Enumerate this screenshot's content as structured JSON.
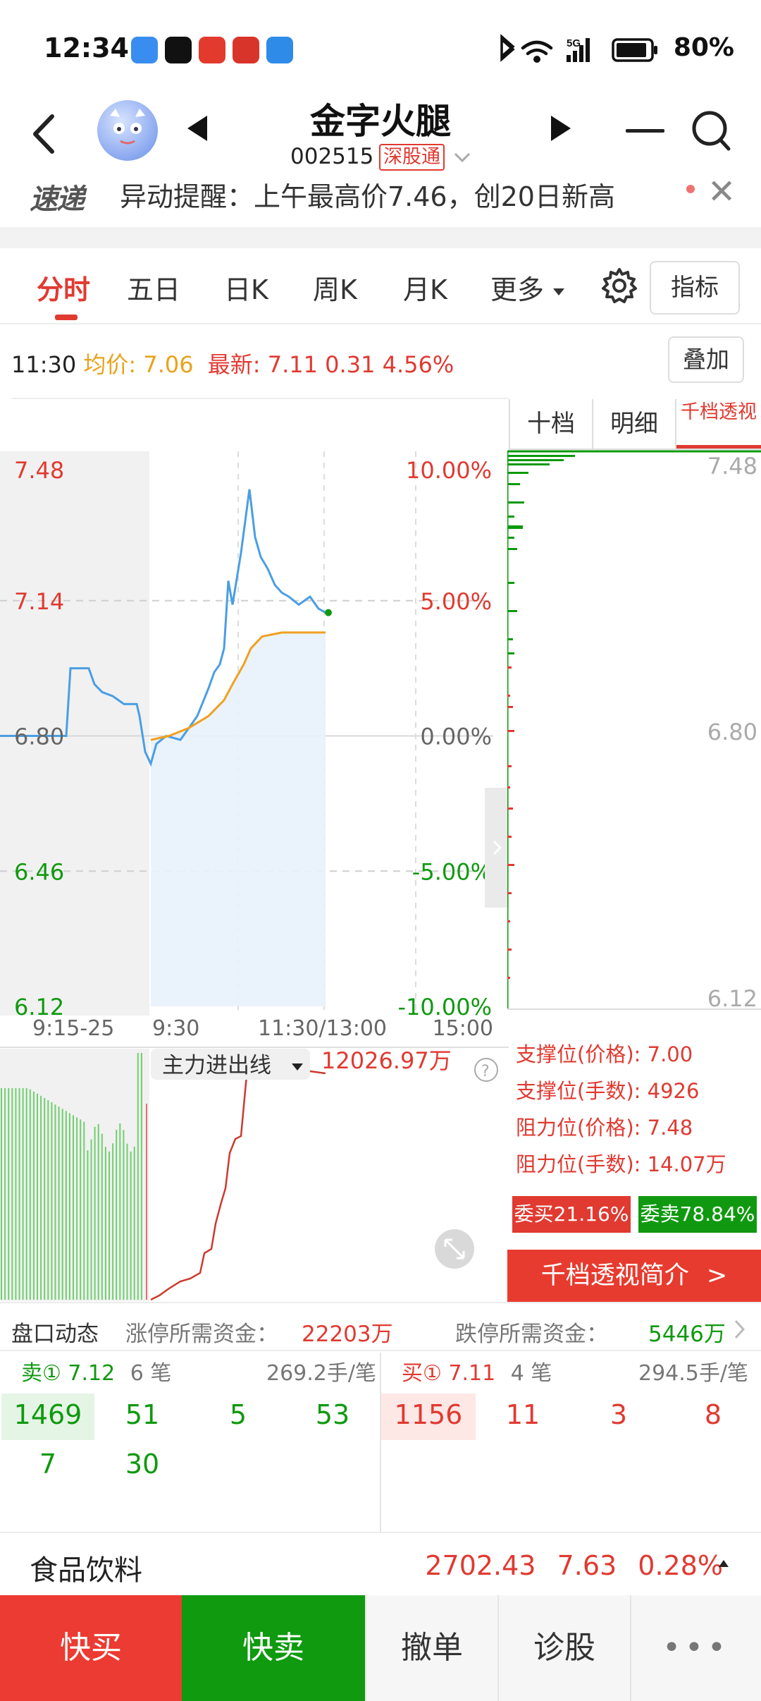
{
  "status_bar": {
    "time": "12:34",
    "battery": "80%",
    "network": "5G"
  },
  "header": {
    "stock_name": "金字火腿",
    "stock_code": "002515",
    "connect_badge": "深股通"
  },
  "alert": {
    "logo": "速递",
    "text": "异动提醒：上午最高价7.46，创20日新高"
  },
  "tabs": [
    {
      "label": "分时",
      "active": true
    },
    {
      "label": "五日"
    },
    {
      "label": "日K"
    },
    {
      "label": "周K"
    },
    {
      "label": "月K"
    },
    {
      "label": "更多"
    }
  ],
  "indicator_label": "指标",
  "overlay_label": "叠加",
  "price_info": {
    "time": "11:30",
    "avg_label": "均价:",
    "avg_value": "7.06",
    "latest_label": "最新:",
    "latest_value": "7.11",
    "change": "0.31",
    "change_pct": "4.56%"
  },
  "chart_data": {
    "type": "line",
    "price_axis": [
      "7.48",
      "7.14",
      "6.80",
      "6.46",
      "6.12"
    ],
    "pct_axis": [
      "10.00%",
      "5.00%",
      "0.00%",
      "-5.00%",
      "-10.00%"
    ],
    "time_axis": [
      "9:15-25",
      "9:30",
      "11:30/13:00",
      "15:00"
    ],
    "ylim": [
      6.12,
      7.48
    ],
    "prev_close": 6.8,
    "series": [
      {
        "color": "#4a9ee3",
        "values": [
          6.8,
          6.8,
          6.8,
          6.8,
          6.97,
          6.97,
          6.97,
          6.93,
          6.91,
          6.9,
          6.88,
          6.88,
          6.85,
          6.76,
          6.73,
          6.78,
          6.8,
          6.79,
          6.83,
          6.85,
          6.92,
          6.96,
          6.98,
          7.02,
          7.19,
          7.13,
          7.26,
          7.42,
          7.3,
          7.25,
          7.22,
          7.18,
          7.16,
          7.15,
          7.13,
          7.15,
          7.12,
          7.11
        ]
      },
      {
        "color": "#f0a020",
        "values": [
          6.79,
          6.8,
          6.82,
          6.85,
          6.89,
          6.93,
          6.98,
          7.02,
          7.05,
          7.06,
          7.06
        ]
      }
    ],
    "flow_indicator": {
      "label": "主力进出线",
      "value": "12026.97万"
    }
  },
  "depth": {
    "tabs": [
      "十档",
      "明细",
      "千档透视"
    ],
    "price_top": "7.48",
    "price_mid": "6.80",
    "price_bottom": "6.12",
    "support_price": "支撑位(价格): 7.00",
    "support_lots": "支撑位(手数): 4926",
    "resist_price": "阻力位(价格): 7.48",
    "resist_lots": "阻力位(手数): 14.07万",
    "buy_ratio": "委买21.16%",
    "sell_ratio": "委卖78.84%",
    "intro": "千档透视简介"
  },
  "pankou": {
    "title": "盘口动态",
    "limit_up_label": "涨停所需资金：",
    "limit_up_value": "22203万",
    "limit_down_label": "跌停所需资金：",
    "limit_down_value": "5446万"
  },
  "order_book": {
    "sell": {
      "label": "卖① 7.12",
      "count": "6 笔",
      "avg": "269.2手/笔",
      "lots": [
        "1469",
        "51",
        "5",
        "53",
        "7",
        "30"
      ]
    },
    "buy": {
      "label": "买① 7.11",
      "count": "4 笔",
      "avg": "294.5手/笔",
      "lots": [
        "1156",
        "11",
        "3",
        "8"
      ]
    }
  },
  "sector": {
    "name": "食品饮料",
    "price": "2702.43",
    "change": "7.63",
    "pct": "0.28%"
  },
  "bottom_bar": {
    "quick_buy": "快买",
    "quick_sell": "快卖",
    "cancel": "撤单",
    "diagnose": "诊股",
    "more": "•••"
  }
}
